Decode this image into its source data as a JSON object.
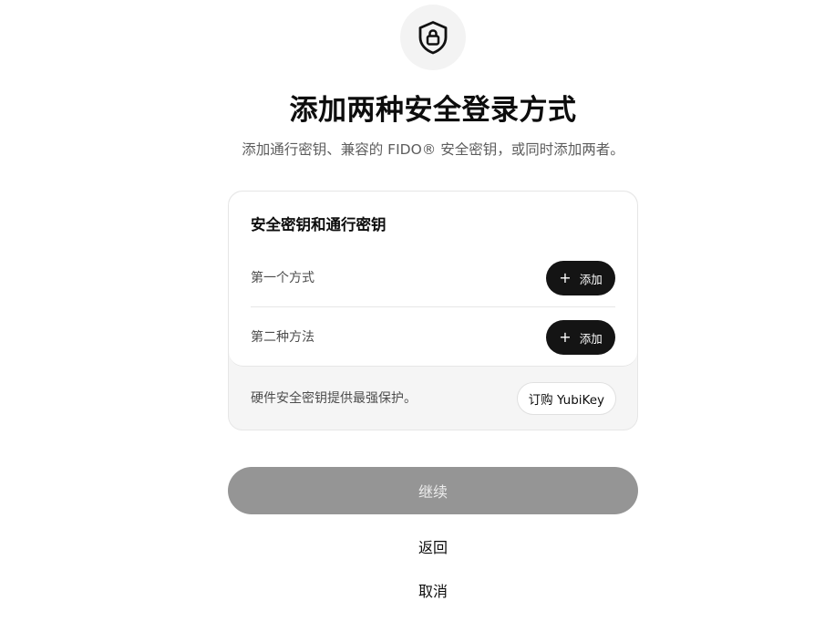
{
  "header": {
    "icon": "shield-lock-icon",
    "title": "添加两种安全登录方式",
    "subtitle": "添加通行密钥、兼容的 FIDO® 安全密钥，或同时添加两者。"
  },
  "card": {
    "heading": "安全密钥和通行密钥",
    "methods": [
      {
        "label": "第一个方式",
        "button_label": "添加",
        "button_icon": "plus-icon"
      },
      {
        "label": "第二种方法",
        "button_label": "添加",
        "button_icon": "plus-icon"
      }
    ],
    "footer_text": "硬件安全密钥提供最强保护。",
    "order_button_label": "订购 YubiKey"
  },
  "actions": {
    "continue_label": "继续",
    "back_label": "返回",
    "cancel_label": "取消"
  },
  "colors": {
    "primary_button": "#141414",
    "disabled_button": "#959595",
    "icon_circle": "#f3f3f3",
    "card_footer_bg": "#f5f5f5"
  }
}
